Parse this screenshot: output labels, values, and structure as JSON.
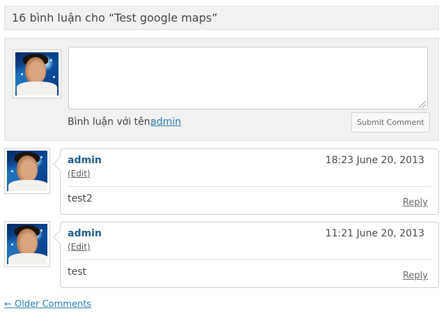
{
  "header": {
    "title": "16 bình luận cho “Test google maps”"
  },
  "comment_form": {
    "textarea_placeholder": "",
    "commenting_as_label": "Bình luận với tên:",
    "commenting_as_user": "admin",
    "submit_label": "Submit Comment"
  },
  "comments": [
    {
      "author": "admin",
      "edit_label": "(Edit)",
      "datetime": "18:23 June 20, 2013",
      "text": "test2",
      "reply_label": "Reply"
    },
    {
      "author": "admin",
      "edit_label": "(Edit)",
      "datetime": "11:21 June 20, 2013",
      "text": "test",
      "reply_label": "Reply"
    }
  ],
  "pagination": {
    "older_label": "← Older Comments"
  }
}
